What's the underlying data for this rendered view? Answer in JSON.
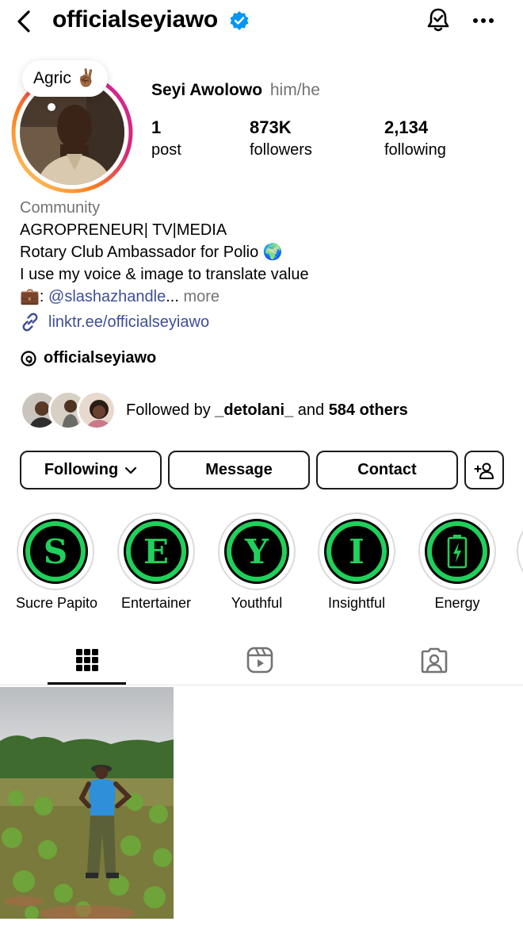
{
  "header": {
    "username": "officialseyiawo",
    "icons": [
      "back-arrow-icon",
      "verified-badge-icon",
      "notification-bell-icon",
      "more-options-icon"
    ]
  },
  "profile": {
    "note": {
      "text": "Agric",
      "emoji": "✌🏾"
    },
    "name": "Seyi Awolowo",
    "pronouns": "him/he",
    "stats": [
      {
        "value": "1",
        "label": "post"
      },
      {
        "value": "873K",
        "label": "followers"
      },
      {
        "value": "2,134",
        "label": "following"
      }
    ]
  },
  "bio": {
    "category": "Community",
    "line1": "AGROPRENEUR| TV|MEDIA",
    "line2": "Rotary Club Ambassador for Polio 🌍",
    "line3": "I use my voice & image to translate value",
    "line4_prefix": "💼: ",
    "line4_mention": "@slashazhandle",
    "line4_ellipsis": "...",
    "more": "more",
    "link": "linktr.ee/officialseyiawo",
    "threads": "officialseyiawo"
  },
  "followed_by": {
    "prefix": "Followed by ",
    "user": "_detolani_",
    "middle": " and ",
    "others": "584 others"
  },
  "buttons": {
    "following": "Following",
    "message": "Message",
    "contact": "Contact"
  },
  "highlights": [
    {
      "label": "Sucre Papito",
      "glyph": "S"
    },
    {
      "label": "Entertainer",
      "glyph": "E"
    },
    {
      "label": "Youthful",
      "glyph": "Y"
    },
    {
      "label": "Insightful",
      "glyph": "I"
    },
    {
      "label": "Energy",
      "glyph": "battery-bolt-icon"
    }
  ],
  "tabs": [
    "grid-icon",
    "reels-icon",
    "tagged-icon"
  ],
  "colors": {
    "link": "#3d4e9a",
    "verified": "#0095f6",
    "highlight_green": "#1fd05a",
    "muted": "#737373"
  }
}
